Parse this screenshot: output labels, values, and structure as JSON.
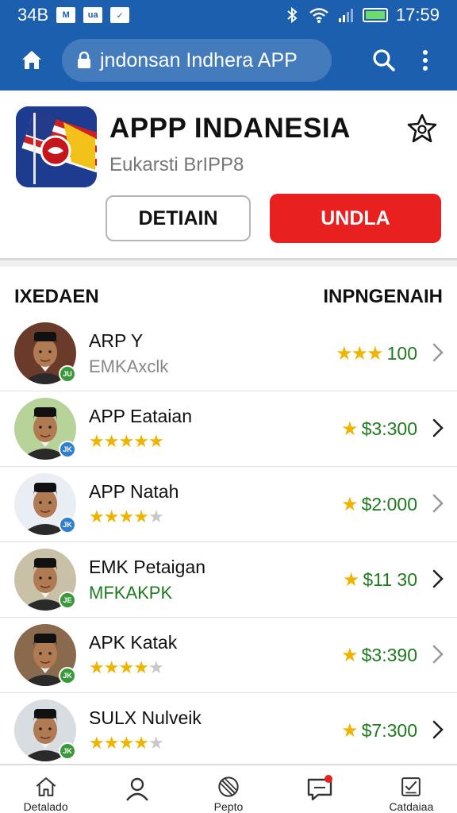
{
  "status_bar": {
    "left_text": "34B",
    "badges": [
      "M",
      "ua",
      "✓"
    ],
    "time": "17:59",
    "battery_level": 1.0
  },
  "app_bar": {
    "url_text": "jndonsan Indhera APP"
  },
  "app": {
    "title": "APPP INDANESIA",
    "subtitle": "Eukarsti BrIPP8",
    "detail_label": "DETIAIN",
    "install_label": "UNDLA"
  },
  "list_header": {
    "left": "IXEDAEN",
    "right": "INPNGENAIH"
  },
  "items": [
    {
      "name": "ARP Y",
      "sub": "EMKAxclk",
      "sub_color": "#888888",
      "rating": null,
      "right_stars": "★★★",
      "value": "100",
      "badge": "JU",
      "badge_color": "#3a9a3a",
      "bg": "#6a3b2a"
    },
    {
      "name": "APP Eataian",
      "sub": null,
      "rating": 5,
      "right_stars": "★",
      "value": "$3:300",
      "badge": "JK",
      "badge_color": "#2f7fd0",
      "bg": "#b7d39a"
    },
    {
      "name": "APP Natah",
      "sub": null,
      "rating": 4,
      "right_stars": "★",
      "value": "$2:000",
      "badge": "JK",
      "badge_color": "#2f7fd0",
      "bg": "#e9eef4"
    },
    {
      "name": "EMK Petaigan",
      "sub": "MFKAKPK",
      "sub_color": "#1e7a1e",
      "rating": null,
      "right_stars": "★",
      "value": "$11 30",
      "badge": "JE",
      "badge_color": "#3a9a3a",
      "bg": "#c9c0a8"
    },
    {
      "name": "APK Katak",
      "sub": null,
      "rating": 4,
      "right_stars": "★",
      "value": "$3:390",
      "badge": "JK",
      "badge_color": "#3a9a3a",
      "bg": "#8a6a4c"
    },
    {
      "name": "SULX Nulveik",
      "sub": null,
      "rating": 4,
      "right_stars": "★",
      "value": "$7:300",
      "badge": "JK",
      "badge_color": "#3a9a3a",
      "bg": "#d8dde2"
    }
  ],
  "bottom_nav": [
    {
      "label": "Detalado",
      "icon": "home-icon"
    },
    {
      "label": "",
      "icon": "user-icon"
    },
    {
      "label": "Pepto",
      "icon": "blocked-icon"
    },
    {
      "label": "",
      "icon": "chat-icon"
    },
    {
      "label": "Catdaiaa",
      "icon": "checklist-icon"
    }
  ],
  "colors": {
    "primary": "#1c5fae",
    "install_button": "#e8201f",
    "star": "#f0b400",
    "price": "#1e7a1e"
  }
}
